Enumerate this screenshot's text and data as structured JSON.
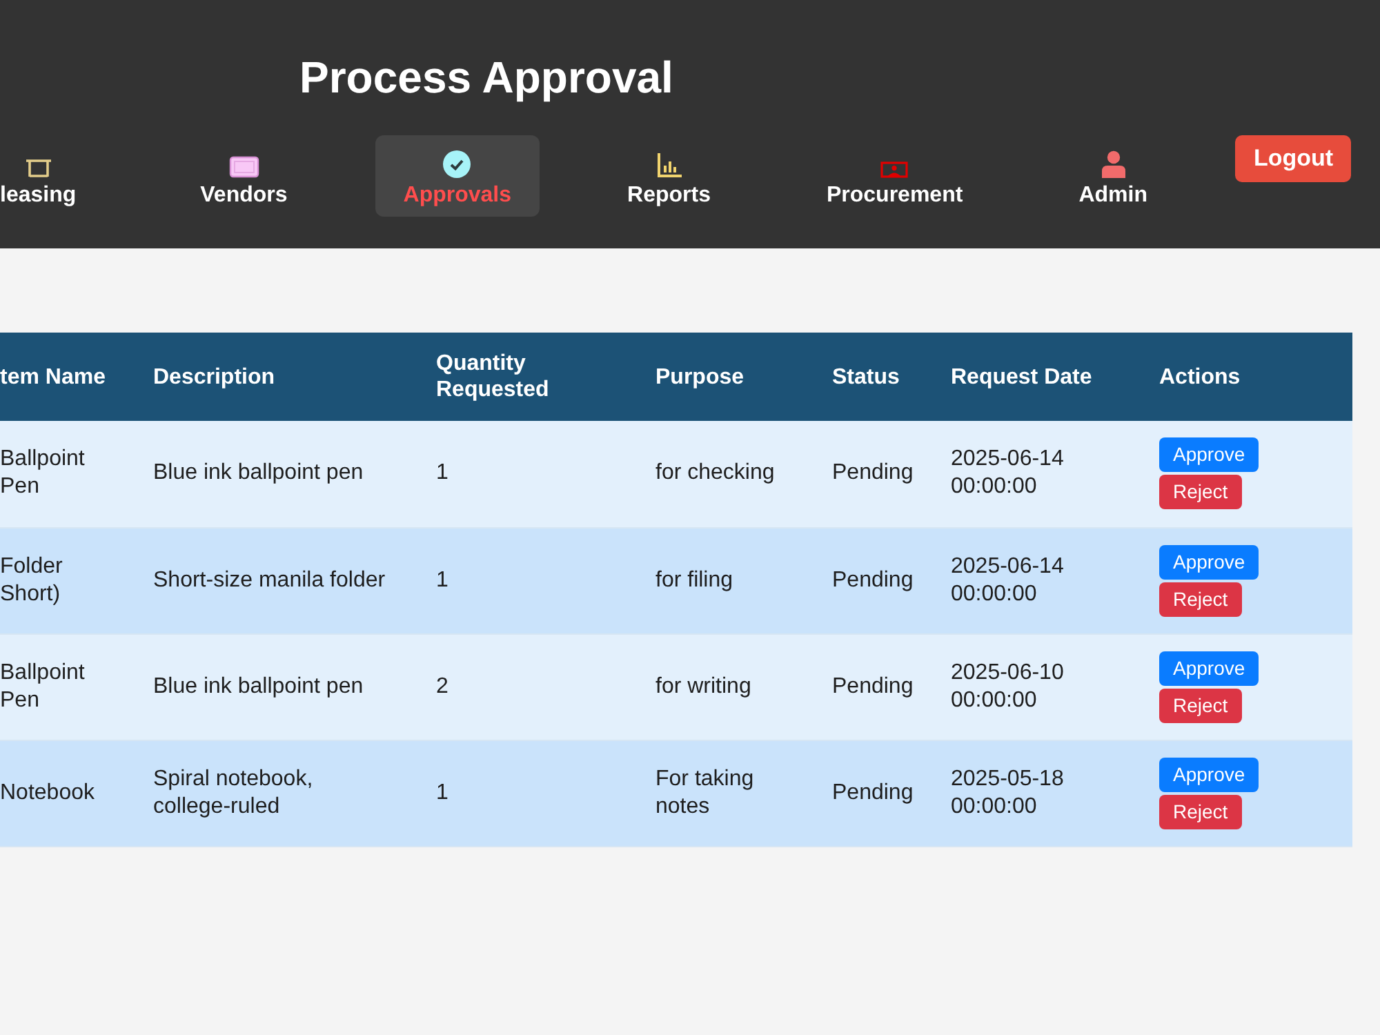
{
  "header": {
    "title": "Process Approval",
    "nav": [
      {
        "label": "leasing",
        "selected": false
      },
      {
        "label": "Vendors",
        "selected": false
      },
      {
        "label": "Approvals",
        "selected": true
      },
      {
        "label": "Reports",
        "selected": false
      },
      {
        "label": "Procurement",
        "selected": false
      },
      {
        "label": "Admin",
        "selected": false
      }
    ],
    "logout": "Logout"
  },
  "table": {
    "columns": [
      "tem Name",
      "Description",
      "Quantity Requested",
      "Purpose",
      "Status",
      "Request Date",
      "Actions"
    ],
    "rows": [
      {
        "item_name": "Ballpoint Pen",
        "description": "Blue ink ballpoint pen",
        "quantity": "1",
        "purpose": "for checking",
        "status": "Pending",
        "request_date": "2025-06-14 00:00:00",
        "actions": [
          {
            "label": "Approve",
            "kind": "approve"
          },
          {
            "label": "Reject",
            "kind": "reject"
          }
        ]
      },
      {
        "item_name": "Folder Short)",
        "description": "Short-size manila folder",
        "quantity": "1",
        "purpose": "for filing",
        "status": "Pending",
        "request_date": "2025-06-14 00:00:00",
        "actions": [
          {
            "label": "Approve",
            "kind": "approve"
          },
          {
            "label": "Reject",
            "kind": "reject"
          }
        ]
      },
      {
        "item_name": "Ballpoint Pen",
        "description": "Blue ink ballpoint pen",
        "quantity": "2",
        "purpose": "for writing",
        "status": "Pending",
        "request_date": "2025-06-10 00:00:00",
        "actions": [
          {
            "label": "Approve",
            "kind": "approve"
          },
          {
            "label": "Reject",
            "kind": "reject"
          }
        ]
      },
      {
        "item_name": "Notebook",
        "description": "Spiral notebook, college-ruled",
        "quantity": "1",
        "purpose": "For taking notes",
        "status": "Pending",
        "request_date": "2025-05-18 00:00:00",
        "actions": [
          {
            "label": "Approve",
            "kind": "approve"
          },
          {
            "label": "Reject",
            "kind": "reject"
          }
        ]
      }
    ]
  }
}
